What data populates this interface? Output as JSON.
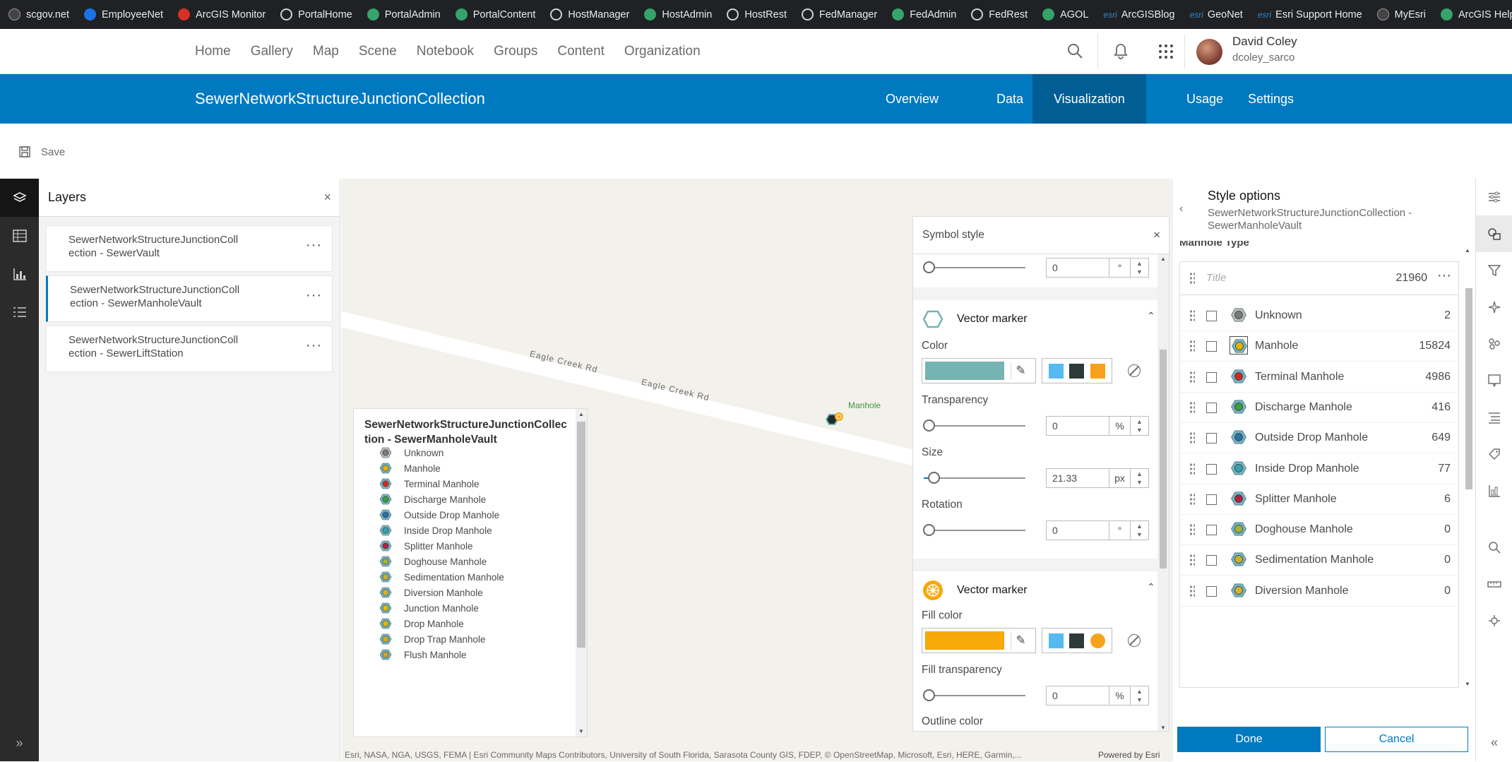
{
  "bookmarks": [
    {
      "label": "scgov.net",
      "icon": "dark"
    },
    {
      "label": "EmployeeNet",
      "icon": "blue"
    },
    {
      "label": "ArcGIS Monitor",
      "icon": "red"
    },
    {
      "label": "PortalHome",
      "icon": "globe"
    },
    {
      "label": "PortalAdmin",
      "icon": "green"
    },
    {
      "label": "PortalContent",
      "icon": "green"
    },
    {
      "label": "HostManager",
      "icon": "globe"
    },
    {
      "label": "HostAdmin",
      "icon": "green"
    },
    {
      "label": "HostRest",
      "icon": "globe"
    },
    {
      "label": "FedManager",
      "icon": "globe"
    },
    {
      "label": "FedAdmin",
      "icon": "green"
    },
    {
      "label": "FedRest",
      "icon": "globe"
    },
    {
      "label": "AGOL",
      "icon": "green"
    },
    {
      "label": "ArcGISBlog",
      "icon": "esri"
    },
    {
      "label": "GeoNet",
      "icon": "esri"
    },
    {
      "label": "Esri Support Home",
      "icon": "esri"
    },
    {
      "label": "MyEsri",
      "icon": "dark"
    },
    {
      "label": "ArcGIS Help",
      "icon": "green"
    }
  ],
  "esri_mark": "esri",
  "nav": {
    "tabs": [
      "Home",
      "Gallery",
      "Map",
      "Scene",
      "Notebook",
      "Groups",
      "Content",
      "Organization"
    ]
  },
  "user": {
    "name": "David Coley",
    "username": "dcoley_sarco"
  },
  "item": {
    "title": "SewerNetworkStructureJunctionCollection",
    "tabs": [
      "Overview",
      "Data",
      "Visualization",
      "Usage",
      "Settings"
    ],
    "active_tab": "Visualization"
  },
  "toolbar": {
    "save_label": "Save"
  },
  "layers": {
    "title": "Layers",
    "items": [
      {
        "line1": "SewerNetworkStructureJunctionColl",
        "line2": "ection - SewerVault"
      },
      {
        "line1": "SewerNetworkStructureJunctionColl",
        "line2": "ection - SewerManholeVault"
      },
      {
        "line1": "SewerNetworkStructureJunctionColl",
        "line2": "ection - SewerLiftStation"
      }
    ]
  },
  "map": {
    "road_label": "Eagle Creek Rd",
    "feature_label": "Manhole",
    "attribution": "Esri, NASA, NGA, USGS, FEMA | Esri Community Maps Contributors, University of South Florida, Sarasota County GIS, FDEP, © OpenStreetMap, Microsoft, Esri, HERE, Garmin,...",
    "powered_by": "Powered by Esri"
  },
  "legend": {
    "title_line1": "SewerNetworkStructureJunctionCollec",
    "title_line2": "tion - SewerManholeVault",
    "items": [
      {
        "label": "Unknown",
        "color": "#bdbdbd",
        "center": "#7a7a7a"
      },
      {
        "label": "Manhole",
        "color": "#6fb6c9",
        "center": "#e8b400"
      },
      {
        "label": "Terminal Manhole",
        "color": "#6fb6c9",
        "center": "#d9261c"
      },
      {
        "label": "Discharge Manhole",
        "color": "#6fb6c9",
        "center": "#3f9c3a"
      },
      {
        "label": "Outside Drop Manhole",
        "color": "#6fb6c9",
        "center": "#2e6fa0"
      },
      {
        "label": "Inside Drop Manhole",
        "color": "#6fb6c9",
        "center": "#3aa0a6"
      },
      {
        "label": "Splitter Manhole",
        "color": "#6fb6c9",
        "center": "#b2223f"
      },
      {
        "label": "Doghouse Manhole",
        "color": "#6fb6c9",
        "center": "#a7b23a"
      },
      {
        "label": "Sedimentation Manhole",
        "color": "#6fb6c9",
        "center": "#cfae2f"
      },
      {
        "label": "Diversion Manhole",
        "color": "#6fb6c9",
        "center": "#d8b22c"
      },
      {
        "label": "Junction Manhole",
        "color": "#6fb6c9",
        "center": "#e0c000"
      },
      {
        "label": "Drop Manhole",
        "color": "#6fb6c9",
        "center": "#e0b800"
      },
      {
        "label": "Drop Trap Manhole",
        "color": "#6fb6c9",
        "center": "#d4ad1f"
      },
      {
        "label": "Flush Manhole",
        "color": "#6fb6c9",
        "center": "#c9a633"
      }
    ]
  },
  "symbol_style": {
    "title": "Symbol style",
    "top_rotation": {
      "value": "0",
      "unit": "°"
    },
    "marker1": {
      "title": "Vector marker",
      "color_label": "Color",
      "color": "#74b4b1",
      "quick_colors": [
        "#55baf2",
        "#2e3a3a",
        "#f7a21b"
      ],
      "transparency_label": "Transparency",
      "transparency": {
        "value": "0",
        "unit": "%"
      },
      "size_label": "Size",
      "size": {
        "value": "21.33",
        "unit": "px"
      },
      "size_fraction": 0.1,
      "rotation_label": "Rotation",
      "rotation": {
        "value": "0",
        "unit": "°"
      }
    },
    "marker2": {
      "title": "Vector marker",
      "fill_label": "Fill color",
      "fill": "#f7a80b",
      "quick_colors": [
        "#55baf2",
        "#2e3a3a",
        "#f7a21b"
      ],
      "fill_transparency_label": "Fill transparency",
      "fill_transparency": {
        "value": "0",
        "unit": "%"
      },
      "outline_label": "Outline color"
    }
  },
  "style_options": {
    "title": "Style options",
    "subtitle": "SewerNetworkStructureJunctionCollection - SewerManholeVault",
    "field": "Manhole Type",
    "title_placeholder": "Title",
    "total": "21960",
    "rows": [
      {
        "label": "Unknown",
        "count": "2",
        "center": "#7a7a7a",
        "ring": "#bdbdbd"
      },
      {
        "label": "Manhole",
        "count": "15824",
        "center": "#e8b400",
        "ring": "#6fb6c9"
      },
      {
        "label": "Terminal Manhole",
        "count": "4986",
        "center": "#d9261c",
        "ring": "#6fb6c9"
      },
      {
        "label": "Discharge Manhole",
        "count": "416",
        "center": "#3f9c3a",
        "ring": "#6fb6c9"
      },
      {
        "label": "Outside Drop Manhole",
        "count": "649",
        "center": "#2e6fa0",
        "ring": "#6fb6c9"
      },
      {
        "label": "Inside Drop Manhole",
        "count": "77",
        "center": "#3aa0a6",
        "ring": "#6fb6c9"
      },
      {
        "label": "Splitter Manhole",
        "count": "6",
        "center": "#b2223f",
        "ring": "#6fb6c9"
      },
      {
        "label": "Doghouse Manhole",
        "count": "0",
        "center": "#a7b23a",
        "ring": "#6fb6c9"
      },
      {
        "label": "Sedimentation Manhole",
        "count": "0",
        "center": "#cfae2f",
        "ring": "#6fb6c9"
      },
      {
        "label": "Diversion Manhole",
        "count": "0",
        "center": "#d8b22c",
        "ring": "#6fb6c9"
      }
    ],
    "done_label": "Done",
    "cancel_label": "Cancel"
  },
  "colors": {
    "brand": "#0079c1",
    "brand_dark": "#005e95"
  }
}
